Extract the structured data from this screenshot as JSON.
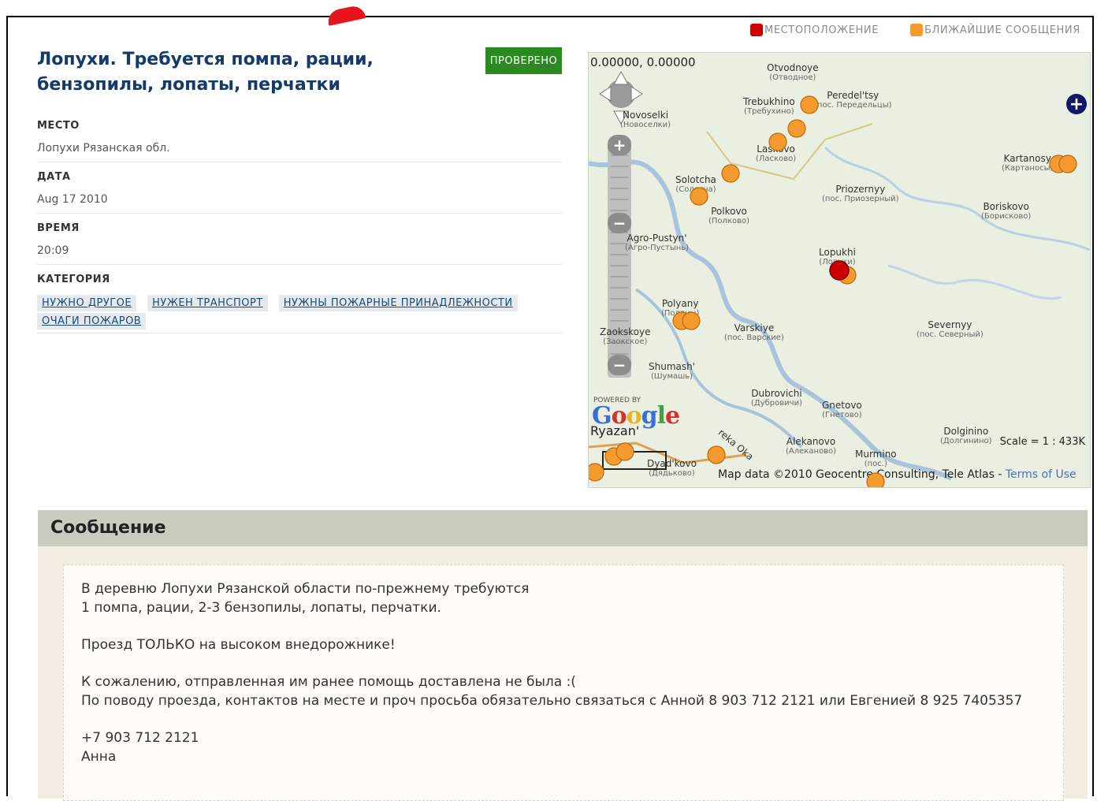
{
  "report": {
    "title": "Лопухи. Требуется помпа, рации, бензопилы, лопаты, перчатки",
    "verified_badge": "ПРОВЕРЕНО",
    "place_label": "МЕСТО",
    "place_value": "Лопухи Рязанская обл.",
    "date_label": "ДАТА",
    "date_value": "Aug 17 2010",
    "time_label": "ВРЕМЯ",
    "time_value": "20:09",
    "category_label": "КАТЕГОРИЯ",
    "categories": [
      "НУЖНО ДРУГОЕ",
      "НУЖЕН ТРАНСПОРТ",
      "НУЖНЫ ПОЖАРНЫЕ ПРИНАДЛЕЖНОСТИ",
      "ОЧАГИ ПОЖАРОВ"
    ]
  },
  "legend": {
    "location": "МЕСТОПОЛОЖЕНИЕ",
    "nearby": "БЛИЖАЙШИЕ СООБЩЕНИЯ",
    "location_color": "#cc0000",
    "nearby_color": "#f59a2c"
  },
  "map": {
    "coordinates": "0.00000, 0.00000",
    "powered_by": "POWERED BY",
    "google": "Google",
    "scale": "Scale = 1 : 433K",
    "attribution": "Map data ©2010 Geocentre Consulting, Tele Atlas -",
    "terms": "Terms of Use",
    "places": [
      {
        "name": "Otvodnoye",
        "sub": "(Отводное)"
      },
      {
        "name": "Trebukhino",
        "sub": "(Требухино)"
      },
      {
        "name": "Peredel'tsy",
        "sub": "(пос. Передельцы)"
      },
      {
        "name": "Novoselki",
        "sub": "(Новоселки)"
      },
      {
        "name": "Laskovo",
        "sub": "(Ласково)"
      },
      {
        "name": "Kartanosy",
        "sub": "(Картаносы)"
      },
      {
        "name": "Solotcha",
        "sub": "(Солотча)"
      },
      {
        "name": "Priozernyy",
        "sub": "(пос. Приозерный)"
      },
      {
        "name": "Polkovo",
        "sub": "(Полково)"
      },
      {
        "name": "Boriskovo",
        "sub": "(Борисково)"
      },
      {
        "name": "Agro-Pustyn'",
        "sub": "(Агро-Пустынь)"
      },
      {
        "name": "Lopukhi",
        "sub": "(Лопухи)"
      },
      {
        "name": "Polyany",
        "sub": "(Поляны)"
      },
      {
        "name": "Zaokskoye",
        "sub": "(Заокское)"
      },
      {
        "name": "Varskiye",
        "sub": "(пос. Варские)"
      },
      {
        "name": "Severnyy",
        "sub": "(пос. Северный)"
      },
      {
        "name": "Shumash'",
        "sub": "(Шумашь)"
      },
      {
        "name": "Dubrovichi",
        "sub": "(Дубровичи)"
      },
      {
        "name": "Gnetovo",
        "sub": "(Гнетово)"
      },
      {
        "name": "Ryazan'",
        "sub": "(Рязань)"
      },
      {
        "name": "Dolginino",
        "sub": "(Долгинино)"
      },
      {
        "name": "Alekanovo",
        "sub": "(Алеканово)"
      },
      {
        "name": "Murmino",
        "sub": "(пос.)"
      },
      {
        "name": "Dyad'kovo",
        "sub": "(Дядьково)"
      },
      {
        "name": "reka Oka",
        "sub": ""
      }
    ]
  },
  "message": {
    "header": "Сообщение",
    "lines": [
      "В деревню Лопухи Рязанской области по-прежнему требуются",
      "1 помпа, рации, 2-3 бензопилы, лопаты, перчатки.",
      "",
      "Проезд ТОЛЬКО на высоком внедорожнике!",
      "",
      "К сожалению, отправленная им ранее помощь доставлена не была :(",
      "По поводу проезда, контактов на месте и проч просьба обязательно связаться с Анной 8 903 712 2121 или Евгенией 8 925 7405357",
      "",
      "+7 903 712 2121",
      "Анна"
    ]
  }
}
